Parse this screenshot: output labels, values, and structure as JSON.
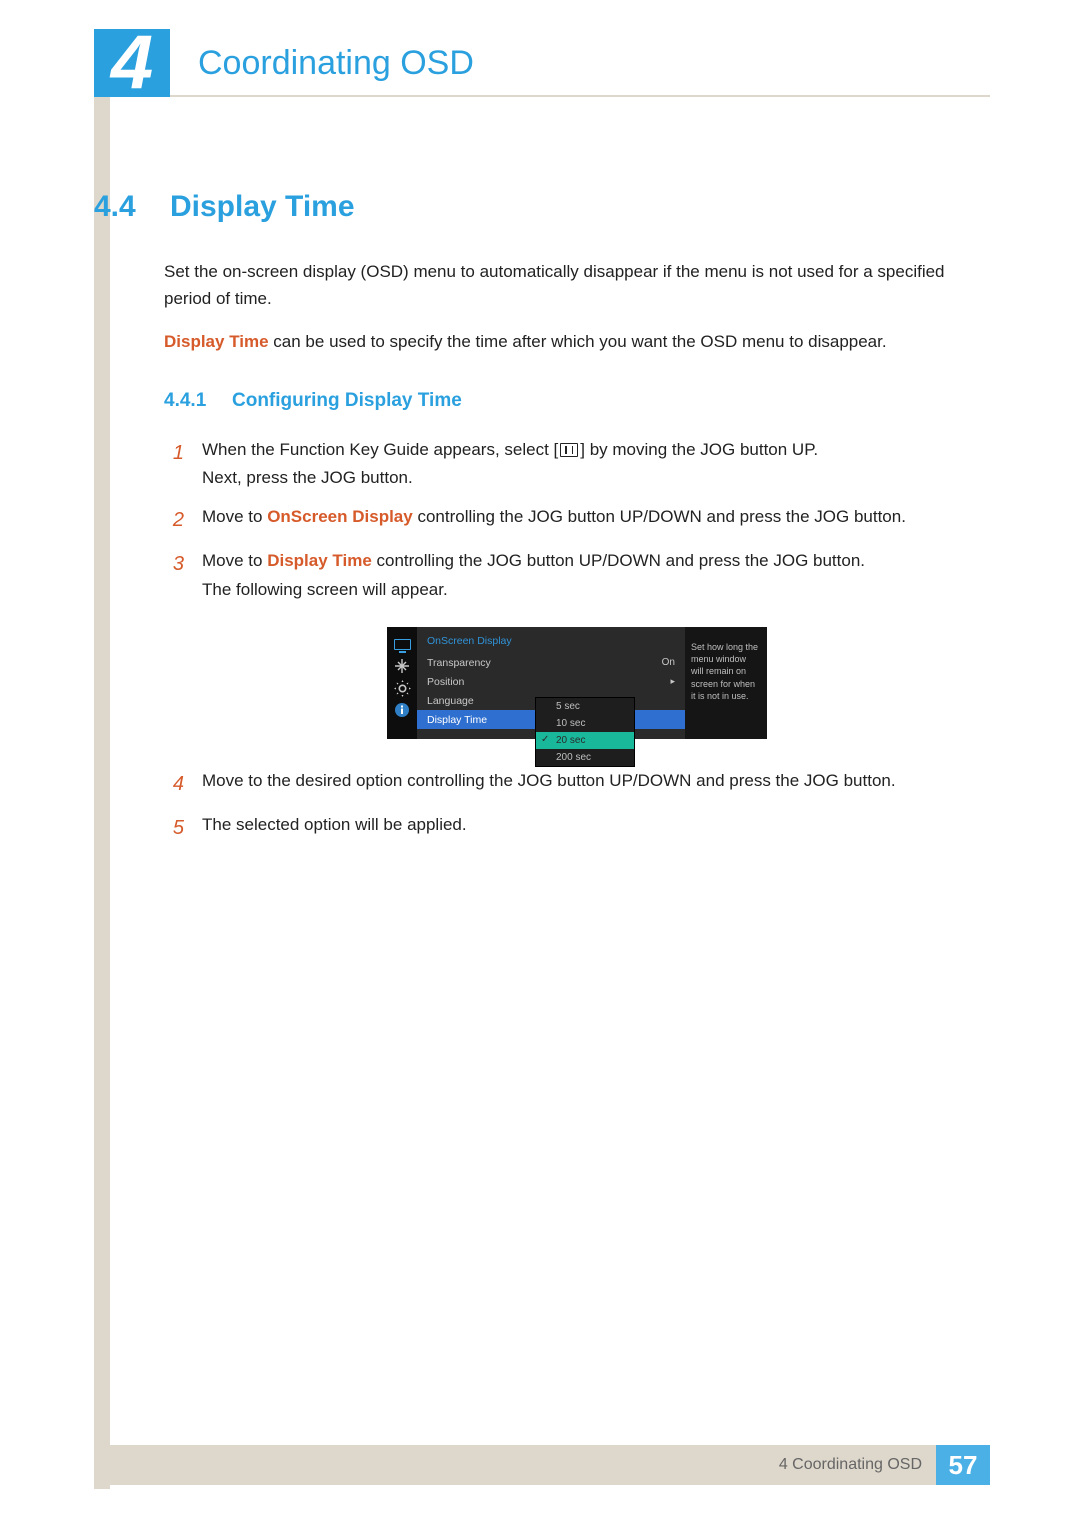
{
  "chapter": {
    "number": "4",
    "title": "Coordinating OSD"
  },
  "section": {
    "number": "4.4",
    "title": "Display Time"
  },
  "intro": {
    "p1": "Set the on-screen display (OSD) menu to automatically disappear if the menu is not used for a specified period of time.",
    "p2a": "Display Time",
    "p2b": " can be used to specify the time after which you want the OSD menu to disappear."
  },
  "subsection": {
    "number": "4.4.1",
    "title": "Configuring Display Time"
  },
  "steps": {
    "s1num": "1",
    "s1a": "When the Function Key Guide appears, select [",
    "s1b": "] by moving the JOG button UP.",
    "s1c": "Next, press the JOG button.",
    "s2num": "2",
    "s2a": "Move to ",
    "s2b": "OnScreen Display",
    "s2c": " controlling the JOG button UP/DOWN and press the JOG button.",
    "s3num": "3",
    "s3a": "Move to ",
    "s3b": "Display Time",
    "s3c": " controlling the JOG button UP/DOWN and press the JOG button.",
    "s3d": "The following screen will appear.",
    "s4num": "4",
    "s4": "Move to the desired option controlling the JOG button UP/DOWN and press the JOG button.",
    "s5num": "5",
    "s5": "The selected option will be applied."
  },
  "osd": {
    "category": "OnScreen Display",
    "items": {
      "transparency": {
        "label": "Transparency",
        "value": "On"
      },
      "position": {
        "label": "Position",
        "value": ""
      },
      "language": {
        "label": "Language",
        "value": ""
      },
      "displaytime": {
        "label": "Display Time",
        "value": ""
      }
    },
    "options": {
      "o1": "5 sec",
      "o2": "10 sec",
      "o3": "20 sec",
      "o4": "200 sec"
    },
    "help": "Set how long the menu window will remain on screen for when it is not in use."
  },
  "footer": {
    "text": "4 Coordinating OSD",
    "page": "57"
  }
}
